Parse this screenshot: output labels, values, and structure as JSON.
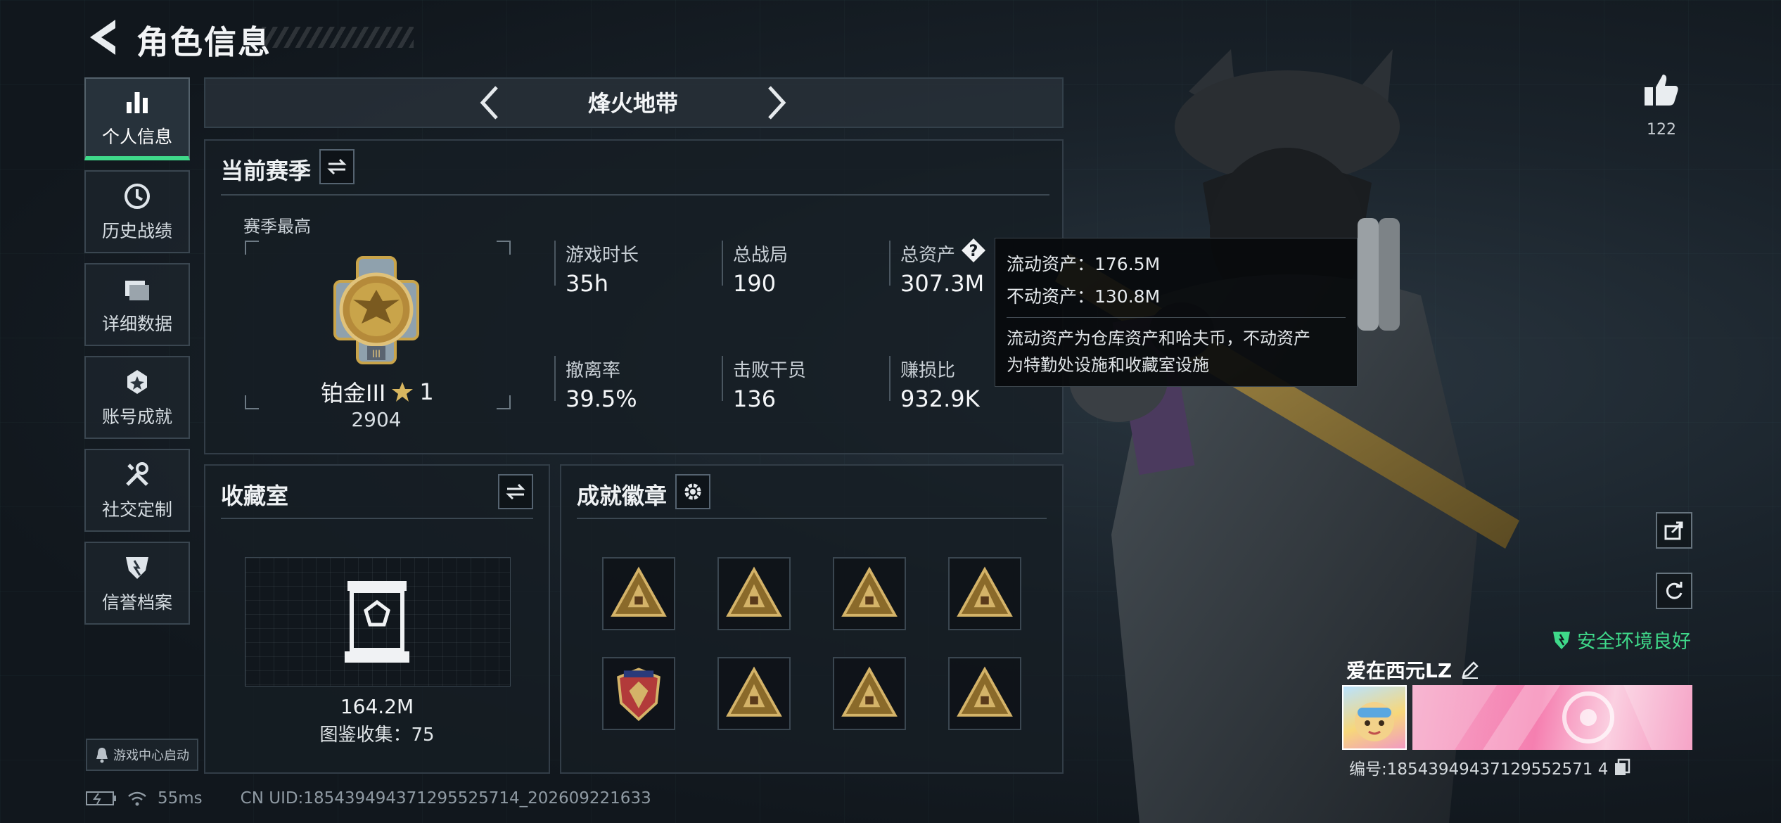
{
  "header": {
    "title": "角色信息"
  },
  "sidebar": {
    "items": [
      {
        "label": "个人信息",
        "icon": "bar-chart-icon",
        "active": true
      },
      {
        "label": "历史战绩",
        "icon": "clock-icon"
      },
      {
        "label": "详细数据",
        "icon": "folder-icon"
      },
      {
        "label": "账号成就",
        "icon": "achievement-icon"
      },
      {
        "label": "社交定制",
        "icon": "wrench-icon"
      },
      {
        "label": "信誉档案",
        "icon": "shield-icon"
      }
    ],
    "launch_label": "游戏中心启动"
  },
  "mode": {
    "name": "烽火地带"
  },
  "season": {
    "title": "当前赛季",
    "best_label": "赛季最高",
    "rank_name": "铂金III",
    "rank_stars": "1",
    "rank_score": "2904",
    "stats": [
      {
        "label": "游戏时长",
        "value": "35h"
      },
      {
        "label": "总战局",
        "value": "190"
      },
      {
        "label": "总资产",
        "value": "307.3M"
      },
      {
        "label": "撤离率",
        "value": "39.5%"
      },
      {
        "label": "击败干员",
        "value": "136"
      },
      {
        "label": "赚损比",
        "value": "932.9K"
      }
    ]
  },
  "tooltip": {
    "liquid": "流动资产：176.5M",
    "fixed": "不动资产：130.8M",
    "desc_1": "流动资产为仓库资产和哈夫币，不动资产",
    "desc_2": "为特勤处设施和收藏室设施"
  },
  "collection": {
    "title": "收藏室",
    "value": "164.2M",
    "count_label": "图鉴收集：75"
  },
  "badges": {
    "title": "成就徽章",
    "count": 8
  },
  "likes": {
    "count": "122"
  },
  "profile": {
    "safety": "安全环境良好",
    "name": "爱在西元LZ",
    "id_line": "编号:18543949437129552571 4"
  },
  "status": {
    "ping": "55ms",
    "uid": "CN UID:185439494371295525714_202609221633"
  },
  "colors": {
    "accent_green": "#3fd98a",
    "gold": "#c9a44a",
    "panel": "#161d24"
  }
}
